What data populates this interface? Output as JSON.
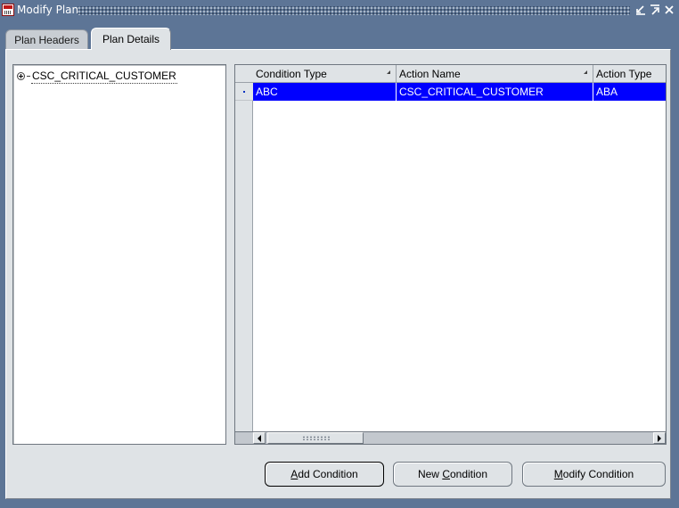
{
  "window": {
    "title": "Modify Plan"
  },
  "tabs": [
    {
      "label": "Plan Headers",
      "active": false
    },
    {
      "label": "Plan Details",
      "active": true
    }
  ],
  "tree": {
    "nodes": [
      {
        "label": "CSC_CRITICAL_CUSTOMER",
        "expanded": false
      }
    ]
  },
  "grid": {
    "columns": [
      {
        "label": "Condition Type",
        "sortable": true
      },
      {
        "label": "Action Name",
        "sortable": true
      },
      {
        "label": "Action Type",
        "sortable": false
      }
    ],
    "rows": [
      {
        "selected": true,
        "cells": [
          "ABC",
          "CSC_CRITICAL_CUSTOMER",
          "ABA"
        ]
      }
    ]
  },
  "buttons": {
    "add_condition": {
      "mnemonic": "A",
      "rest": "dd Condition"
    },
    "new_condition": {
      "prefix": "New ",
      "mnemonic": "C",
      "rest": "ondition"
    },
    "modify_condition": {
      "mnemonic": "M",
      "rest": "odify Condition"
    }
  },
  "colors": {
    "window_bg": "#5d7596",
    "panel_bg": "#dfe3e6",
    "selection": "#0000ff"
  }
}
